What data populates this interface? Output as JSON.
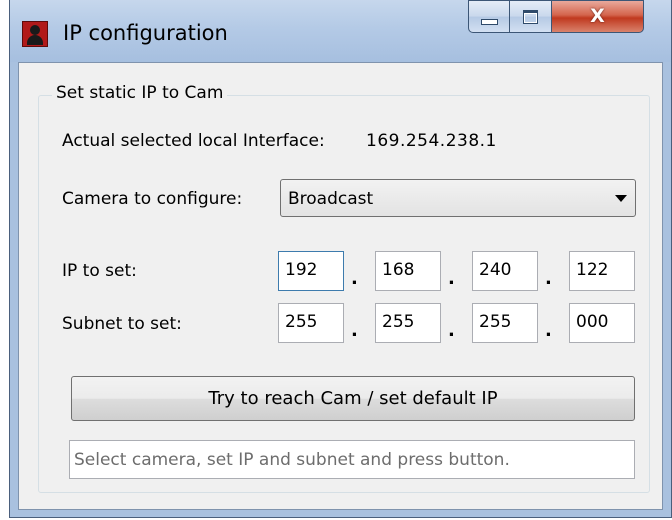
{
  "window": {
    "title": "IP configuration",
    "icon": "camera-person-icon",
    "caption_buttons": {
      "minimize": "minimize-icon",
      "maximize": "maximize-icon",
      "close": "X"
    }
  },
  "group": {
    "title": "Set static IP to Cam",
    "interface_label": "Actual selected local Interface:",
    "interface_value": "169.254.238.1",
    "camera_label": "Camera to configure:",
    "camera_selected": "Broadcast",
    "ip_label": "IP to set:",
    "ip": [
      "192",
      "168",
      "240",
      "122"
    ],
    "subnet_label": "Subnet to set:",
    "subnet": [
      "255",
      "255",
      "255",
      "000"
    ],
    "dot": ".",
    "button_label": "Try to reach Cam / set default IP",
    "status_text": "Select camera, set IP and subnet and press button."
  }
}
